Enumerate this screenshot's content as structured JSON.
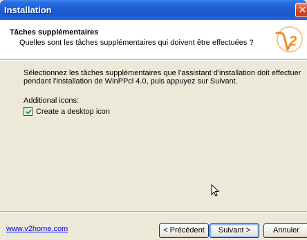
{
  "window": {
    "title": "Installation",
    "close_glyph": "✕"
  },
  "header": {
    "title": "Tâches supplémentaires",
    "subtitle": "Quelles sont les tâches supplémentaires qui doivent être effectuées ?",
    "logo_text": "V2"
  },
  "content": {
    "description_line1": "Sélectionnez les tâches supplémentaires que l'assistant d'installation doit effectuer",
    "description_line2": "pendant l'installation de WinPPcl 4.0, puis appuyez sur Suivant.",
    "group_label": "Additional icons:",
    "tasks": [
      {
        "label": "Create a desktop icon",
        "checked": true
      }
    ]
  },
  "footer": {
    "link_text": "www.v2home.com",
    "prev_label": "< Précédent",
    "next_label": "Suivant >",
    "cancel_label": "Annuler"
  },
  "colors": {
    "titlebar": "#1e5fd6",
    "dialog_bg": "#ece9d8",
    "link": "#0000ff",
    "logo": "#f08a1c"
  }
}
